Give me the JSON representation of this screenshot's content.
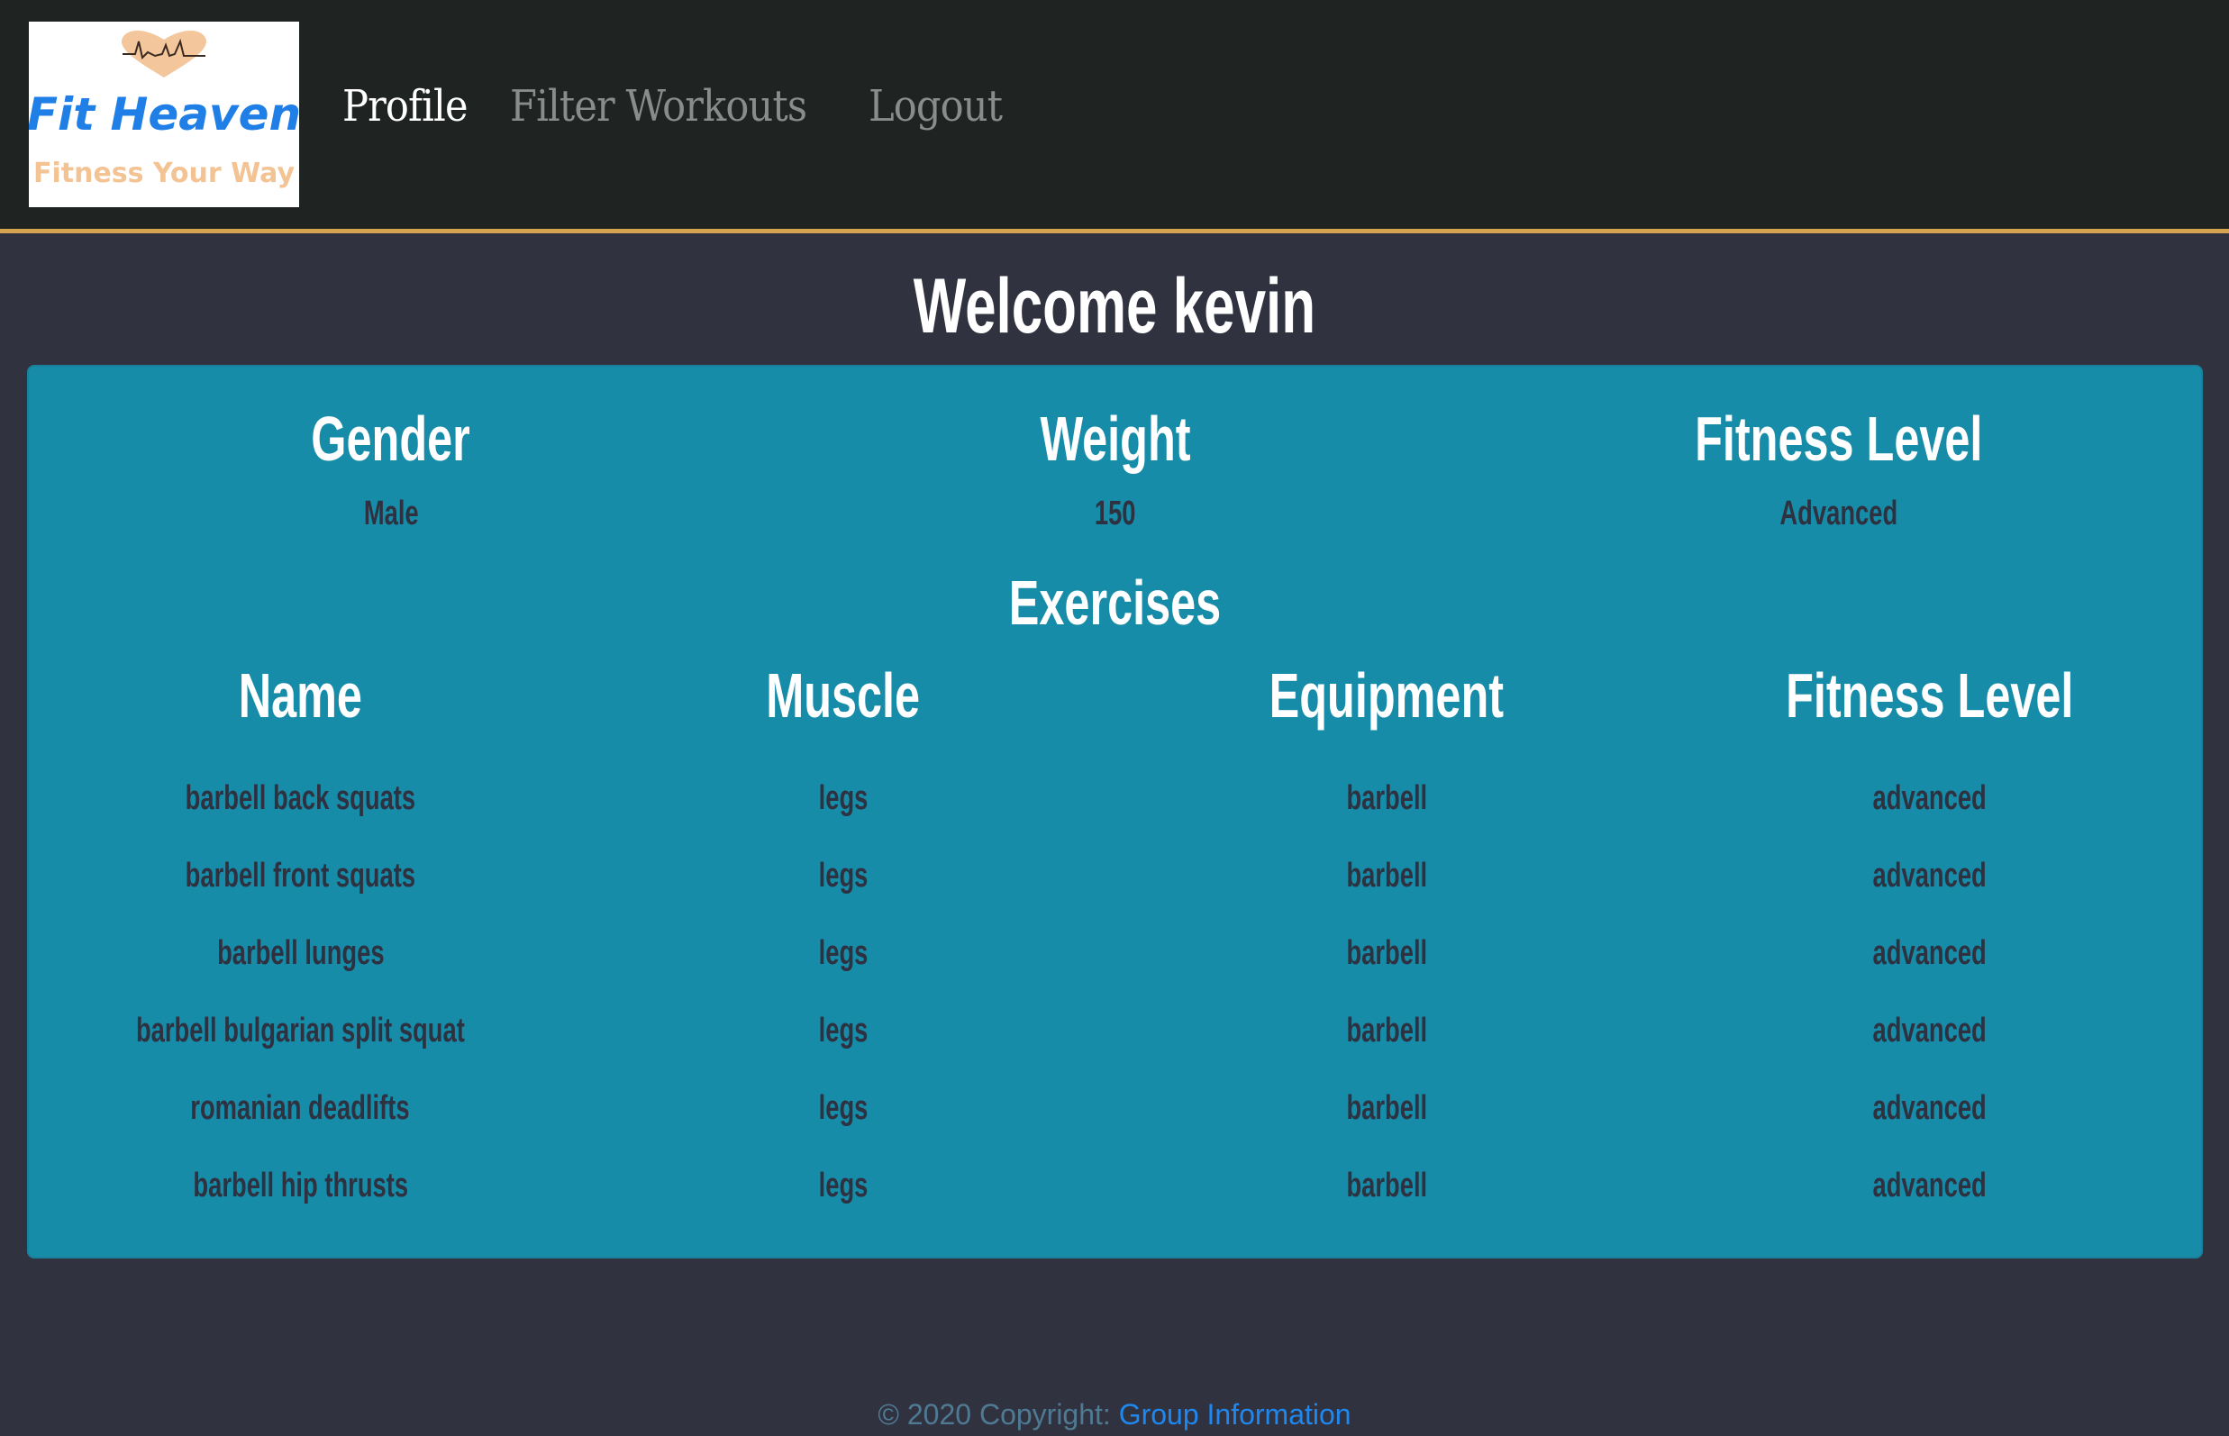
{
  "header": {
    "logo": {
      "title": "Fit Heaven",
      "tagline": "Fitness Your Way",
      "icon": "heart-heartbeat-icon"
    },
    "nav": [
      {
        "label": "Profile",
        "active": true
      },
      {
        "label": "Filter Workouts",
        "active": false
      },
      {
        "label": "Logout",
        "active": false
      }
    ]
  },
  "welcome": "Welcome kevin",
  "profile": {
    "stats": [
      {
        "label": "Gender",
        "value": "Male"
      },
      {
        "label": "Weight",
        "value": "150"
      },
      {
        "label": "Fitness Level",
        "value": "Advanced"
      }
    ]
  },
  "exercises": {
    "title": "Exercises",
    "columns": [
      "Name",
      "Muscle",
      "Equipment",
      "Fitness Level"
    ],
    "rows": [
      [
        "barbell back squats",
        "legs",
        "barbell",
        "advanced"
      ],
      [
        "barbell front squats",
        "legs",
        "barbell",
        "advanced"
      ],
      [
        "barbell lunges",
        "legs",
        "barbell",
        "advanced"
      ],
      [
        "barbell bulgarian split squat",
        "legs",
        "barbell",
        "advanced"
      ],
      [
        "romanian deadlifts",
        "legs",
        "barbell",
        "advanced"
      ],
      [
        "barbell hip thrusts",
        "legs",
        "barbell",
        "advanced"
      ]
    ]
  },
  "footer": {
    "copyright": "© 2020 Copyright: ",
    "link_label": "Group Information"
  },
  "colors": {
    "header_bg": "#1f2322",
    "accent_gold": "#d6a44f",
    "page_bg": "#31323f",
    "card_bg": "#178ca9",
    "value_text": "#2e3240",
    "link": "#1e88f0"
  }
}
